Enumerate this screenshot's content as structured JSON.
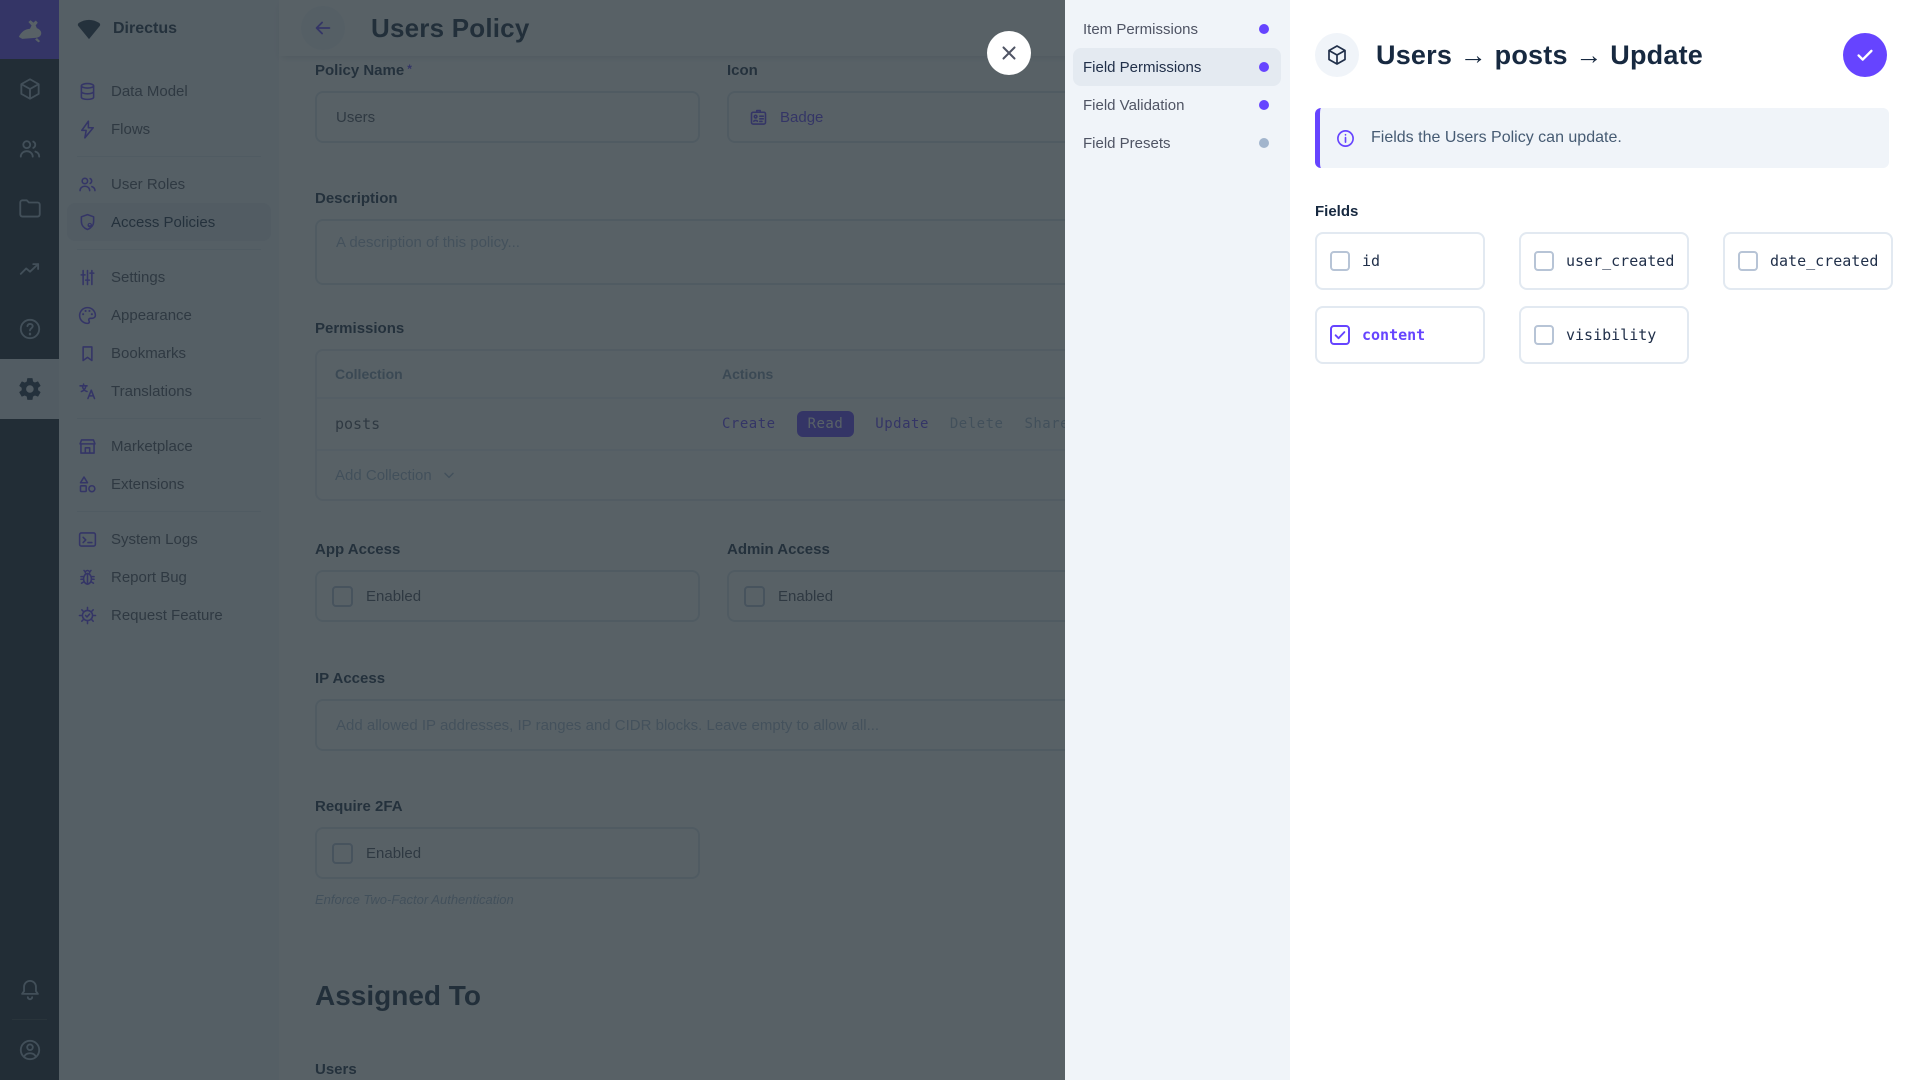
{
  "brand": {
    "accent": "#6644ff",
    "project_name": "Directus"
  },
  "module_bar": {
    "modules": [
      "content",
      "users",
      "files",
      "insights",
      "documentation",
      "settings"
    ],
    "active_module": "settings",
    "bottom": [
      "notifications",
      "account"
    ]
  },
  "nav": {
    "project_name": "Directus",
    "items": [
      {
        "label": "Data Model",
        "icon": "database-icon"
      },
      {
        "label": "Flows",
        "icon": "bolt-icon"
      },
      {
        "label": "User Roles",
        "icon": "people-icon"
      },
      {
        "label": "Access Policies",
        "icon": "shield-lock-icon",
        "active": true
      },
      {
        "label": "Settings",
        "icon": "tune-icon"
      },
      {
        "label": "Appearance",
        "icon": "palette-icon"
      },
      {
        "label": "Bookmarks",
        "icon": "bookmark-icon"
      },
      {
        "label": "Translations",
        "icon": "translate-icon"
      },
      {
        "label": "Marketplace",
        "icon": "storefront-icon"
      },
      {
        "label": "Extensions",
        "icon": "extensions-icon"
      },
      {
        "label": "System Logs",
        "icon": "terminal-icon"
      },
      {
        "label": "Report Bug",
        "icon": "bug-icon"
      },
      {
        "label": "Request Feature",
        "icon": "feature-icon"
      }
    ]
  },
  "main": {
    "title": "Users Policy",
    "fields": {
      "policy_name_label": "Policy Name",
      "policy_name_required": "*",
      "policy_name_value": "Users",
      "icon_label": "Icon",
      "icon_value": "Badge",
      "description_label": "Description",
      "description_placeholder": "A description of this policy...",
      "permissions_label": "Permissions",
      "app_access_label": "App Access",
      "admin_access_label": "Admin Access",
      "enabled_label": "Enabled",
      "ip_access_label": "IP Access",
      "ip_access_placeholder": "Add allowed IP addresses, IP ranges and CIDR blocks. Leave empty to allow all...",
      "require_2fa_label": "Require 2FA",
      "require_2fa_note": "Enforce Two-Factor Authentication",
      "assigned_to_label": "Assigned To",
      "users_label": "Users"
    },
    "permissions_table": {
      "columns": [
        "Collection",
        "Actions"
      ],
      "rows": [
        {
          "collection": "posts",
          "actions": [
            {
              "label": "Create",
              "state": "active"
            },
            {
              "label": "Read",
              "state": "active-solid"
            },
            {
              "label": "Update",
              "state": "active"
            },
            {
              "label": "Delete",
              "state": "muted"
            },
            {
              "label": "Share",
              "state": "muted"
            }
          ]
        }
      ],
      "add_row_label": "Add Collection"
    }
  },
  "drawer": {
    "nav": [
      {
        "label": "Item Permissions",
        "dot": "purple",
        "active": false
      },
      {
        "label": "Field Permissions",
        "dot": "purple",
        "active": true
      },
      {
        "label": "Field Validation",
        "dot": "purple",
        "active": false
      },
      {
        "label": "Field Presets",
        "dot": "gray",
        "active": false
      }
    ],
    "title": "Users → posts → Update",
    "notice": "Fields the Users Policy can update.",
    "fields_label": "Fields",
    "field_checkboxes": [
      {
        "label": "id",
        "checked": false
      },
      {
        "label": "user_created",
        "checked": false
      },
      {
        "label": "date_created",
        "checked": false
      },
      {
        "label": "content",
        "checked": true
      },
      {
        "label": "visibility",
        "checked": false
      }
    ]
  }
}
